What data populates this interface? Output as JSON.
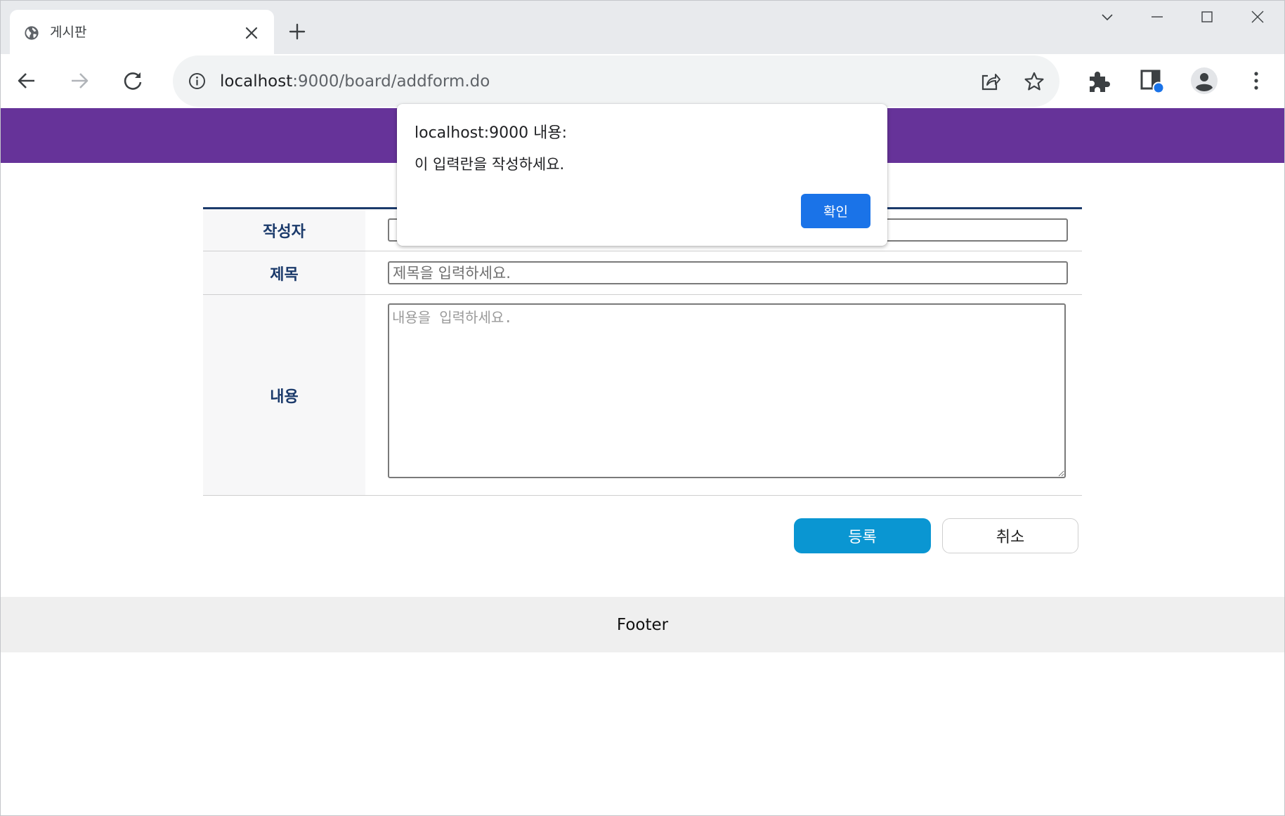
{
  "tab": {
    "title": "게시판",
    "icon": "globe-icon"
  },
  "window_controls": [
    "chevron-down-icon",
    "minimize-icon",
    "maximize-icon",
    "close-icon"
  ],
  "toolbar": {
    "url_host": "localhost",
    "url_path": ":9000/board/addform.do",
    "icons": [
      "back-arrow-icon",
      "forward-arrow-icon",
      "reload-icon",
      "info-icon",
      "share-icon",
      "star-icon",
      "puzzle-icon",
      "side-panel-icon",
      "profile-icon",
      "kebab-menu-icon"
    ]
  },
  "form": {
    "rows": [
      {
        "label": "작성자",
        "value": ""
      },
      {
        "label": "제목",
        "placeholder": "제목을 입력하세요."
      },
      {
        "label": "내용",
        "placeholder": "내용을 입력하세요."
      }
    ],
    "submit_label": "등록",
    "cancel_label": "취소"
  },
  "footer": {
    "text": "Footer"
  },
  "dialog": {
    "title": "localhost:9000 내용:",
    "message": "이 입력란을 작성하세요.",
    "ok_label": "확인"
  },
  "colors": {
    "header": "#663399",
    "label_text": "#1b3a6b",
    "submit_button": "#0a96d2",
    "dialog_button": "#1a73e8"
  }
}
